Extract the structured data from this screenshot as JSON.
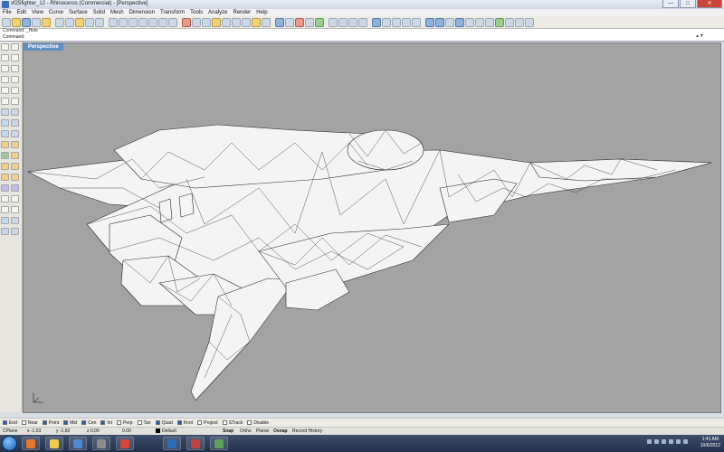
{
  "window": {
    "title": "vf25fighter_12 - Rhinoceros (Commercial) - [Perspective]",
    "buttons": [
      "—",
      "□",
      "✕"
    ]
  },
  "menu": [
    "File",
    "Edit",
    "View",
    "Curve",
    "Surface",
    "Solid",
    "Mesh",
    "Dimension",
    "Transform",
    "Tools",
    "Analyze",
    "Render",
    "Help"
  ],
  "command": {
    "history": "Command: _Hide",
    "label": "Command:",
    "value": ""
  },
  "viewport": {
    "title": "Perspective",
    "axes": {
      "x": "x",
      "y": "y",
      "z": "z"
    }
  },
  "osnaps": [
    {
      "label": "End",
      "checked": true
    },
    {
      "label": "Near",
      "checked": false
    },
    {
      "label": "Point",
      "checked": true
    },
    {
      "label": "Mid",
      "checked": true
    },
    {
      "label": "Cen",
      "checked": true
    },
    {
      "label": "Int",
      "checked": true
    },
    {
      "label": "Perp",
      "checked": false
    },
    {
      "label": "Tan",
      "checked": false
    },
    {
      "label": "Quad",
      "checked": true
    },
    {
      "label": "Knot",
      "checked": true
    },
    {
      "label": "Project",
      "checked": false
    },
    {
      "label": "STrack",
      "checked": false
    },
    {
      "label": "Disable",
      "checked": false
    }
  ],
  "status": {
    "cplane": "CPlane",
    "x": "x -1.63",
    "y": "y -1.82",
    "z": "z 0.00",
    "units": "0.00",
    "layer": "Default",
    "snap": "Snap",
    "ortho": "Ortho",
    "planar": "Planar",
    "osnap": "Osnap",
    "record": "Record History"
  },
  "taskbar": {
    "time": "1:41 AM",
    "date": "10/6/2012",
    "apps": [
      {
        "name": "firefox",
        "color": "#e8762c"
      },
      {
        "name": "explorer",
        "color": "#f2c94c"
      },
      {
        "name": "media",
        "color": "#4a8ad4"
      },
      {
        "name": "rhino",
        "color": "#8c8c8c"
      },
      {
        "name": "chrome",
        "color": "#d8473a"
      },
      {
        "name": "photoshop",
        "color": "#2c6fb8"
      },
      {
        "name": "app7",
        "color": "#c74040"
      },
      {
        "name": "app8",
        "color": "#5fa05b"
      }
    ]
  },
  "colors": {
    "viewport_bg": "#a3a3a3",
    "mesh_fill": "#f4f4f4",
    "mesh_line": "#2a2a2a",
    "active_tab": "#5f8fc2"
  }
}
